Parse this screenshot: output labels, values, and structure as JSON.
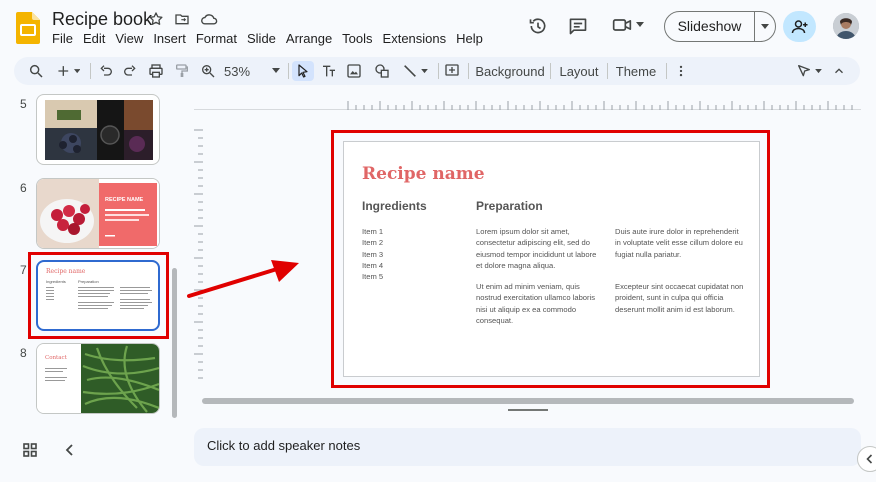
{
  "app": {
    "doc_title": "Recipe book",
    "menu": [
      "File",
      "Edit",
      "View",
      "Insert",
      "Format",
      "Slide",
      "Arrange",
      "Tools",
      "Extensions",
      "Help"
    ],
    "slideshow_label": "Slideshow"
  },
  "toolbar": {
    "zoom": "53%",
    "background_label": "Background",
    "layout_label": "Layout",
    "theme_label": "Theme"
  },
  "filmstrip": {
    "slides": [
      {
        "number": "5"
      },
      {
        "number": "6",
        "title": "RECIPE NAME"
      },
      {
        "number": "7",
        "title": "Recipe name",
        "col1": "Ingredients",
        "col2": "Preparation"
      },
      {
        "number": "8",
        "title": "Contact"
      }
    ]
  },
  "slide": {
    "title": "Recipe name",
    "ingredients_heading": "Ingredients",
    "preparation_heading": "Preparation",
    "items": [
      "Item 1",
      "Item 2",
      "Item 3",
      "Item 4",
      "Item 5"
    ],
    "paragraphs": [
      "Lorem ipsum dolor sit amet, consectetur adipiscing elit, sed do eiusmod tempor incididunt ut labore et dolore magna aliqua.",
      "Ut enim ad minim veniam, quis nostrud exercitation ullamco laboris nisi ut aliquip ex ea commodo consequat.",
      "Duis aute irure dolor in reprehenderit in voluptate velit esse cillum dolore eu fugiat nulla pariatur.",
      "Excepteur sint occaecat cupidatat non proident, sunt in culpa qui officia deserunt mollit anim id est laborum."
    ],
    "title_color": "#e06666"
  },
  "notes": {
    "placeholder": "Click to add speaker notes"
  },
  "colors": {
    "annotation": "#e00000",
    "selection": "#2f6ad0",
    "accent": "#e06666"
  }
}
